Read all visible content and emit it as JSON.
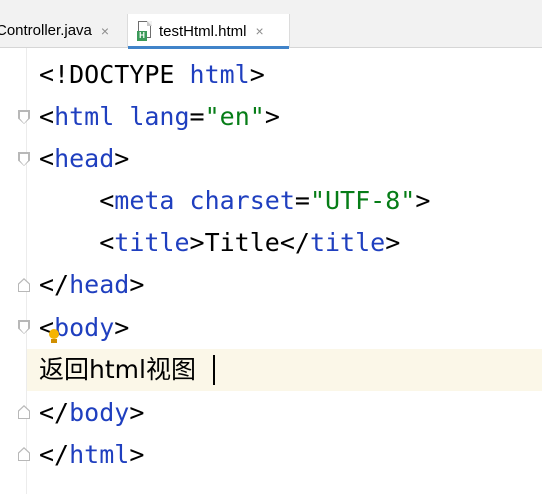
{
  "tabs": [
    {
      "label": "Controller.java",
      "close": "×",
      "active": false
    },
    {
      "label": "testHtml.html",
      "close": "×",
      "active": true,
      "icon": "html-file-icon",
      "badge": "H"
    }
  ],
  "editor": {
    "lines": [
      {
        "parts": [
          [
            "txt",
            "<!DOCTYPE "
          ],
          [
            "tag",
            "html"
          ],
          [
            "txt",
            ">"
          ]
        ]
      },
      {
        "parts": [
          [
            "txt",
            "<"
          ],
          [
            "tag",
            "html "
          ],
          [
            "attr",
            "lang"
          ],
          [
            "txt",
            "="
          ],
          [
            "val",
            "\"en\""
          ],
          [
            "txt",
            ">"
          ]
        ]
      },
      {
        "parts": [
          [
            "txt",
            "<"
          ],
          [
            "tag",
            "head"
          ],
          [
            "txt",
            ">"
          ]
        ]
      },
      {
        "parts": [
          [
            "txt",
            "    <"
          ],
          [
            "tag",
            "meta "
          ],
          [
            "attr",
            "charset"
          ],
          [
            "txt",
            "="
          ],
          [
            "val",
            "\"UTF-8\""
          ],
          [
            "txt",
            ">"
          ]
        ]
      },
      {
        "parts": [
          [
            "txt",
            "    <"
          ],
          [
            "tag",
            "title"
          ],
          [
            "txt",
            ">Title</"
          ],
          [
            "tag",
            "title"
          ],
          [
            "txt",
            ">"
          ]
        ]
      },
      {
        "parts": [
          [
            "txt",
            "</"
          ],
          [
            "tag",
            "head"
          ],
          [
            "txt",
            ">"
          ]
        ]
      },
      {
        "parts": [
          [
            "txt",
            "<"
          ],
          [
            "tag",
            "body"
          ],
          [
            "txt",
            ">"
          ]
        ]
      },
      {
        "parts": [
          [
            "txt",
            "返回html视图"
          ]
        ]
      },
      {
        "parts": [
          [
            "txt",
            "</"
          ],
          [
            "tag",
            "body"
          ],
          [
            "txt",
            ">"
          ]
        ]
      },
      {
        "parts": [
          [
            "txt",
            "</"
          ],
          [
            "tag",
            "html"
          ],
          [
            "txt",
            ">"
          ]
        ]
      }
    ],
    "current_line": 7,
    "intention_icon": "lightbulb-icon"
  },
  "colors": {
    "tag": "#1f3fbf",
    "value": "#067d17",
    "current_line_bg": "#fbf7e8",
    "tab_active_underline": "#4083c9"
  }
}
